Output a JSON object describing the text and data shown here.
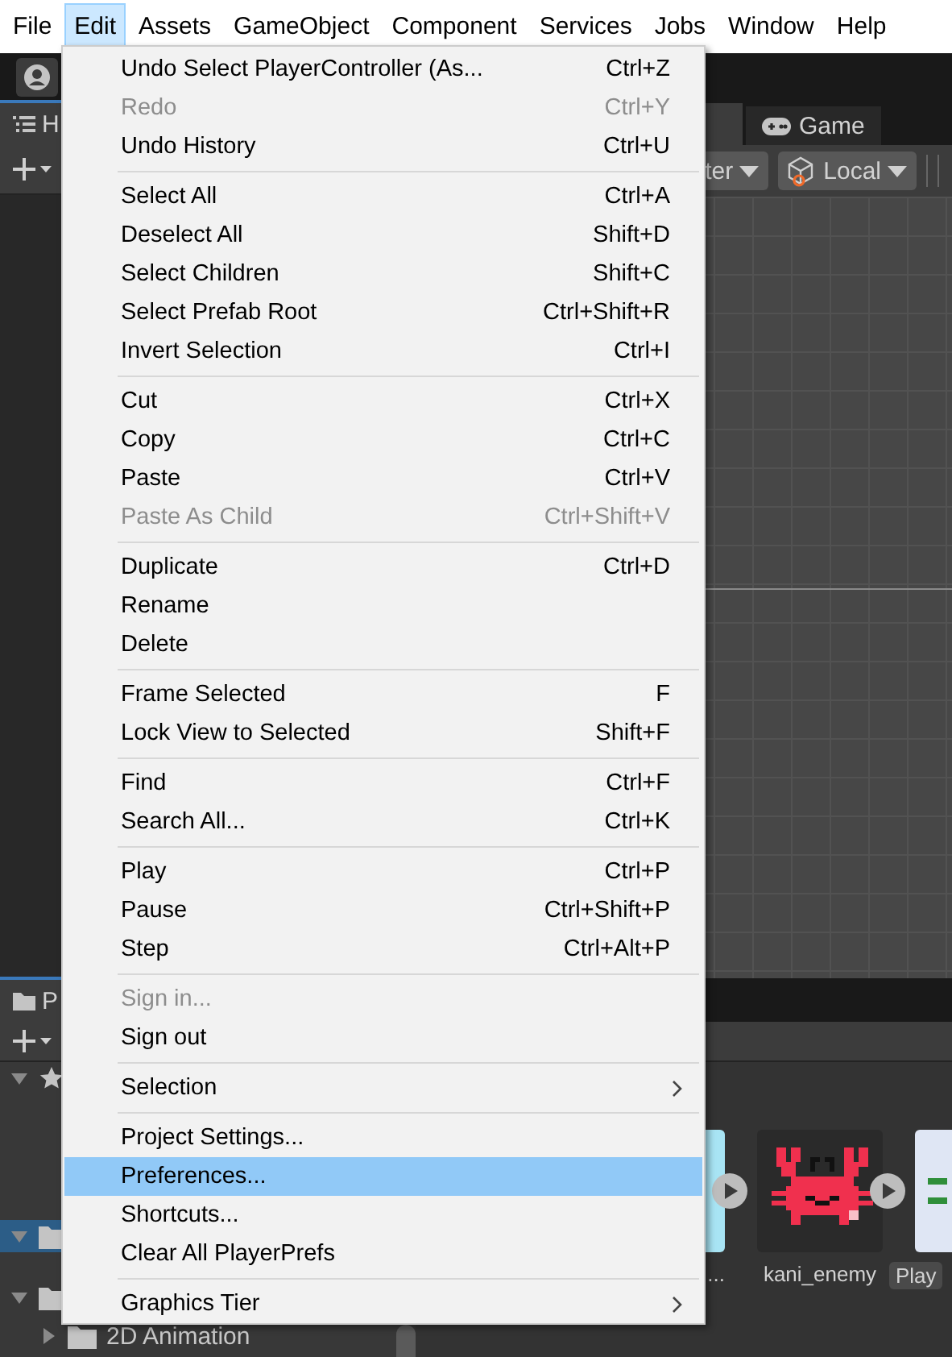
{
  "menubar": [
    {
      "label": "File",
      "selected": false
    },
    {
      "label": "Edit",
      "selected": true
    },
    {
      "label": "Assets",
      "selected": false
    },
    {
      "label": "GameObject",
      "selected": false
    },
    {
      "label": "Component",
      "selected": false
    },
    {
      "label": "Services",
      "selected": false
    },
    {
      "label": "Jobs",
      "selected": false
    },
    {
      "label": "Window",
      "selected": false
    },
    {
      "label": "Help",
      "selected": false
    }
  ],
  "hierarchy": {
    "tab": "H"
  },
  "scene": {
    "game_tab": "Game",
    "pivot_dropdown": "ter",
    "space_dropdown": "Local"
  },
  "project": {
    "tab": "P",
    "tree": [
      {
        "kind": "favorites",
        "expanded": true,
        "selected": false
      },
      {
        "kind": "folder",
        "expanded": true,
        "selected": true
      },
      {
        "kind": "folder",
        "expanded": true,
        "selected": false,
        "children": [
          {
            "kind": "folder",
            "label": "2D Animation",
            "expanded": false,
            "selected": false
          }
        ]
      }
    ],
    "assets": [
      {
        "kind": "sky",
        "label": "..."
      },
      {
        "kind": "crab",
        "label": "kani_enemy"
      },
      {
        "kind": "script",
        "label": "Play"
      }
    ]
  },
  "edit_menu": [
    {
      "kind": "item",
      "label": "Undo Select PlayerController (As...",
      "shortcut": "Ctrl+Z",
      "disabled": false,
      "selected": false
    },
    {
      "kind": "item",
      "label": "Redo",
      "shortcut": "Ctrl+Y",
      "disabled": true,
      "selected": false
    },
    {
      "kind": "item",
      "label": "Undo History",
      "shortcut": "Ctrl+U",
      "disabled": false,
      "selected": false
    },
    {
      "kind": "separator"
    },
    {
      "kind": "item",
      "label": "Select All",
      "shortcut": "Ctrl+A",
      "disabled": false,
      "selected": false
    },
    {
      "kind": "item",
      "label": "Deselect All",
      "shortcut": "Shift+D",
      "disabled": false,
      "selected": false
    },
    {
      "kind": "item",
      "label": "Select Children",
      "shortcut": "Shift+C",
      "disabled": false,
      "selected": false
    },
    {
      "kind": "item",
      "label": "Select Prefab Root",
      "shortcut": "Ctrl+Shift+R",
      "disabled": false,
      "selected": false
    },
    {
      "kind": "item",
      "label": "Invert Selection",
      "shortcut": "Ctrl+I",
      "disabled": false,
      "selected": false
    },
    {
      "kind": "separator"
    },
    {
      "kind": "item",
      "label": "Cut",
      "shortcut": "Ctrl+X",
      "disabled": false,
      "selected": false
    },
    {
      "kind": "item",
      "label": "Copy",
      "shortcut": "Ctrl+C",
      "disabled": false,
      "selected": false
    },
    {
      "kind": "item",
      "label": "Paste",
      "shortcut": "Ctrl+V",
      "disabled": false,
      "selected": false
    },
    {
      "kind": "item",
      "label": "Paste As Child",
      "shortcut": "Ctrl+Shift+V",
      "disabled": true,
      "selected": false
    },
    {
      "kind": "separator"
    },
    {
      "kind": "item",
      "label": "Duplicate",
      "shortcut": "Ctrl+D",
      "disabled": false,
      "selected": false
    },
    {
      "kind": "item",
      "label": "Rename",
      "disabled": false,
      "selected": false
    },
    {
      "kind": "item",
      "label": "Delete",
      "disabled": false,
      "selected": false
    },
    {
      "kind": "separator"
    },
    {
      "kind": "item",
      "label": "Frame Selected",
      "shortcut": "F",
      "disabled": false,
      "selected": false
    },
    {
      "kind": "item",
      "label": "Lock View to Selected",
      "shortcut": "Shift+F",
      "disabled": false,
      "selected": false
    },
    {
      "kind": "separator"
    },
    {
      "kind": "item",
      "label": "Find",
      "shortcut": "Ctrl+F",
      "disabled": false,
      "selected": false
    },
    {
      "kind": "item",
      "label": "Search All...",
      "shortcut": "Ctrl+K",
      "disabled": false,
      "selected": false
    },
    {
      "kind": "separator"
    },
    {
      "kind": "item",
      "label": "Play",
      "shortcut": "Ctrl+P",
      "disabled": false,
      "selected": false
    },
    {
      "kind": "item",
      "label": "Pause",
      "shortcut": "Ctrl+Shift+P",
      "disabled": false,
      "selected": false
    },
    {
      "kind": "item",
      "label": "Step",
      "shortcut": "Ctrl+Alt+P",
      "disabled": false,
      "selected": false
    },
    {
      "kind": "separator"
    },
    {
      "kind": "item",
      "label": "Sign in...",
      "disabled": true,
      "selected": false
    },
    {
      "kind": "item",
      "label": "Sign out",
      "disabled": false,
      "selected": false
    },
    {
      "kind": "separator"
    },
    {
      "kind": "submenu",
      "label": "Selection",
      "disabled": false,
      "selected": false
    },
    {
      "kind": "separator"
    },
    {
      "kind": "item",
      "label": "Project Settings...",
      "disabled": false,
      "selected": false
    },
    {
      "kind": "item",
      "label": "Preferences...",
      "disabled": false,
      "selected": true
    },
    {
      "kind": "item",
      "label": "Shortcuts...",
      "disabled": false,
      "selected": false
    },
    {
      "kind": "item",
      "label": "Clear All PlayerPrefs",
      "disabled": false,
      "selected": false
    },
    {
      "kind": "separator"
    },
    {
      "kind": "submenu",
      "label": "Graphics Tier",
      "disabled": false,
      "selected": false
    }
  ]
}
